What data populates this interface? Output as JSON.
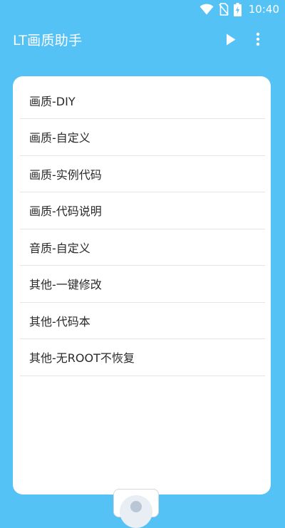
{
  "status_bar": {
    "time": "10:40",
    "icons": [
      "wifi-icon",
      "no-sim-icon",
      "battery-charging-icon"
    ]
  },
  "app_bar": {
    "title": "LT画质助手",
    "actions": [
      "play-icon",
      "more-vert-icon"
    ]
  },
  "menu": {
    "items": [
      {
        "label": "画质-DIY"
      },
      {
        "label": "画质-自定义"
      },
      {
        "label": "画质-实例代码"
      },
      {
        "label": "画质-代码说明"
      },
      {
        "label": "音质-自定义"
      },
      {
        "label": "其他-一键修改"
      },
      {
        "label": "其他-代码本"
      },
      {
        "label": "其他-无ROOT不恢复"
      }
    ]
  },
  "colors": {
    "background": "#55C2F6",
    "card": "#FFFFFF",
    "text": "#2A2A2A",
    "divider": "#E5E5E5"
  }
}
